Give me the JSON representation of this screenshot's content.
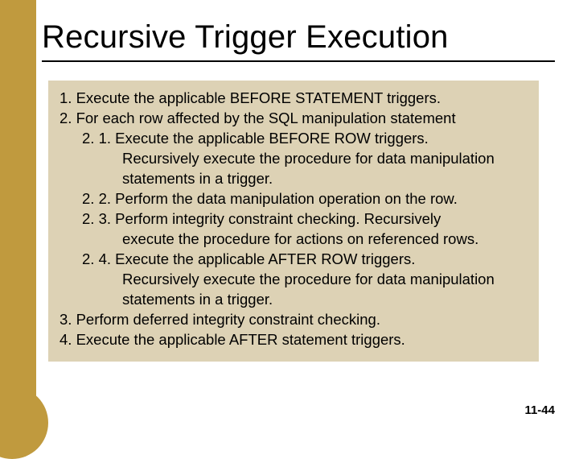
{
  "title": "Recursive Trigger Execution",
  "lines": [
    {
      "cls": "",
      "text": "1. Execute the applicable BEFORE STATEMENT triggers."
    },
    {
      "cls": "",
      "text": "2. For each row affected by the SQL manipulation statement"
    },
    {
      "cls": "ind1",
      "text": "2. 1. Execute the applicable BEFORE ROW triggers."
    },
    {
      "cls": "ind2",
      "text": "Recursively execute the procedure for data manipulation"
    },
    {
      "cls": "ind2",
      "text": "statements in a trigger."
    },
    {
      "cls": "ind1",
      "text": "2. 2. Perform the data manipulation operation on the row."
    },
    {
      "cls": "ind1",
      "text": "2. 3. Perform integrity constraint checking. Recursively"
    },
    {
      "cls": "ind2",
      "text": "execute the procedure for actions on referenced rows."
    },
    {
      "cls": "ind1",
      "text": "2. 4. Execute the applicable AFTER ROW triggers."
    },
    {
      "cls": "ind2",
      "text": "Recursively execute the procedure for data manipulation"
    },
    {
      "cls": "ind2",
      "text": "statements in a trigger."
    },
    {
      "cls": "",
      "text": "3. Perform deferred integrity constraint checking."
    },
    {
      "cls": "",
      "text": "4. Execute the applicable AFTER statement triggers."
    }
  ],
  "page_number": "11-44"
}
